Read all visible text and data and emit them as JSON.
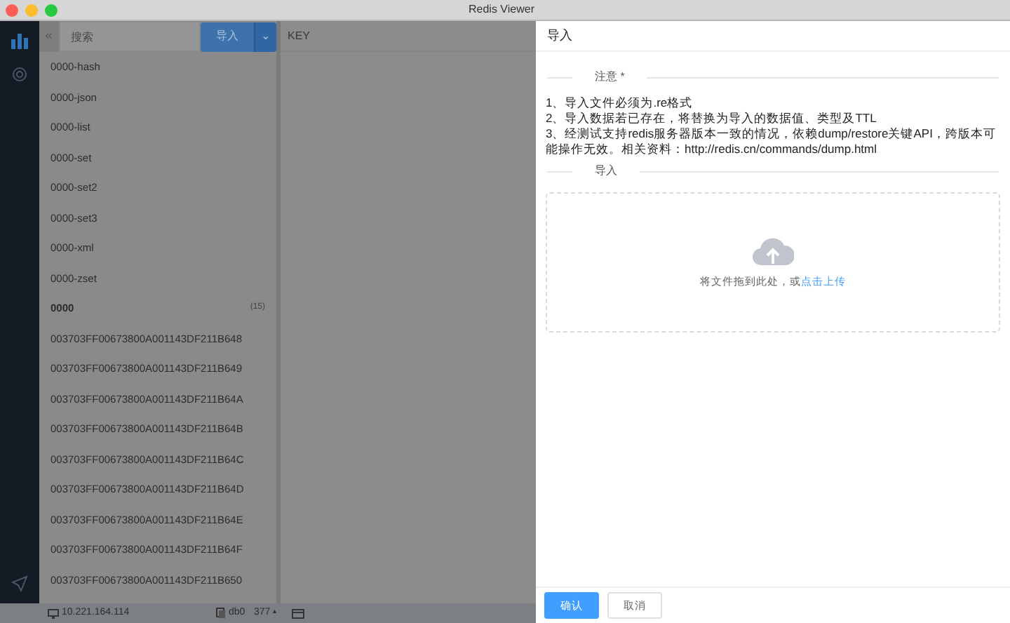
{
  "window": {
    "title": "Redis Viewer"
  },
  "toolbar": {
    "collapse": "«",
    "search": {
      "placeholder": "搜索"
    },
    "import_button": "导入",
    "dropdown": "⌄"
  },
  "keys": [
    {
      "name": "0000-hash",
      "kind": "key"
    },
    {
      "name": "0000-json",
      "kind": "key"
    },
    {
      "name": "0000-list",
      "kind": "key"
    },
    {
      "name": "0000-set",
      "kind": "key"
    },
    {
      "name": "0000-set2",
      "kind": "key"
    },
    {
      "name": "0000-set3",
      "kind": "key"
    },
    {
      "name": "0000-xml",
      "kind": "key"
    },
    {
      "name": "0000-zset",
      "kind": "key"
    },
    {
      "name": "0000",
      "kind": "folder",
      "count": "(15)"
    },
    {
      "name": "003703FF00673800A001143DF211B648",
      "kind": "key"
    },
    {
      "name": "003703FF00673800A001143DF211B649",
      "kind": "key"
    },
    {
      "name": "003703FF00673800A001143DF211B64A",
      "kind": "key"
    },
    {
      "name": "003703FF00673800A001143DF211B64B",
      "kind": "key"
    },
    {
      "name": "003703FF00673800A001143DF211B64C",
      "kind": "key"
    },
    {
      "name": "003703FF00673800A001143DF211B64D",
      "kind": "key"
    },
    {
      "name": "003703FF00673800A001143DF211B64E",
      "kind": "key"
    },
    {
      "name": "003703FF00673800A001143DF211B64F",
      "kind": "key"
    },
    {
      "name": "003703FF00673800A001143DF211B650",
      "kind": "key"
    }
  ],
  "main": {
    "header": "KEY"
  },
  "status_bar": {
    "host": "10.221.164.114",
    "db": "db0",
    "count": "377",
    "count_caret": "▴"
  },
  "drawer": {
    "title": "导入",
    "notice_label": "注意 *",
    "notes": [
      "1、导入文件必须为.re格式",
      "2、导入数据若已存在，将替换为导入的数据值、类型及TTL",
      "3、经测试支持redis服务器版本一致的情况，依赖dump/restore关键API，跨版本可能操作无效。相关资料：http://redis.cn/commands/dump.html"
    ],
    "import_label": "导入",
    "dropzone": {
      "text": "将文件拖到此处，或",
      "link": "点击上传"
    },
    "buttons": [
      {
        "label": "确认",
        "kind": "primary"
      },
      {
        "label": "取消",
        "kind": "default"
      }
    ]
  }
}
